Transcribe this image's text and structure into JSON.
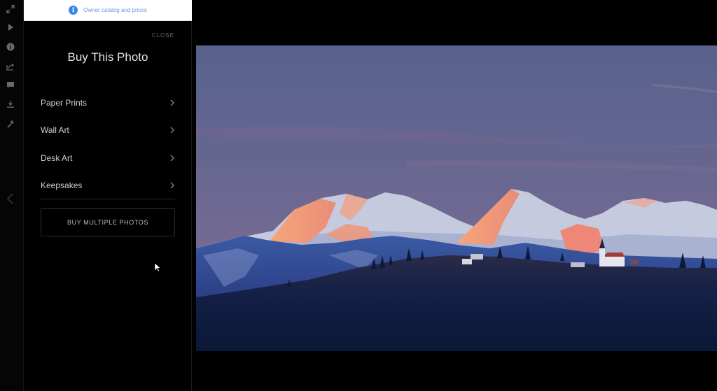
{
  "rail": {
    "icons": [
      {
        "name": "expand-icon"
      },
      {
        "name": "play-icon"
      },
      {
        "name": "info-icon"
      },
      {
        "name": "share-icon"
      },
      {
        "name": "comment-icon"
      },
      {
        "name": "download-icon"
      },
      {
        "name": "wrench-icon"
      }
    ],
    "prev_icon": "chevron-left-icon"
  },
  "owner_bar": {
    "icon": "i",
    "text": "Owner catalog and prices"
  },
  "panel": {
    "close_label": "CLOSE",
    "title": "Buy This Photo",
    "menu": [
      {
        "label": "Paper Prints"
      },
      {
        "label": "Wall Art"
      },
      {
        "label": "Desk Art"
      },
      {
        "label": "Keepsakes"
      }
    ],
    "multi_button_label": "BUY MULTIPLE PHOTOS"
  },
  "photo": {
    "subject": "alpine-sunset-mountains-with-church",
    "colors": {
      "sky_top": "#5b6590",
      "sky_bottom": "#7a6d92",
      "alpenglow": "#f2926d",
      "snow": "#c8cde0",
      "foreground": "#0e1a3a"
    }
  }
}
